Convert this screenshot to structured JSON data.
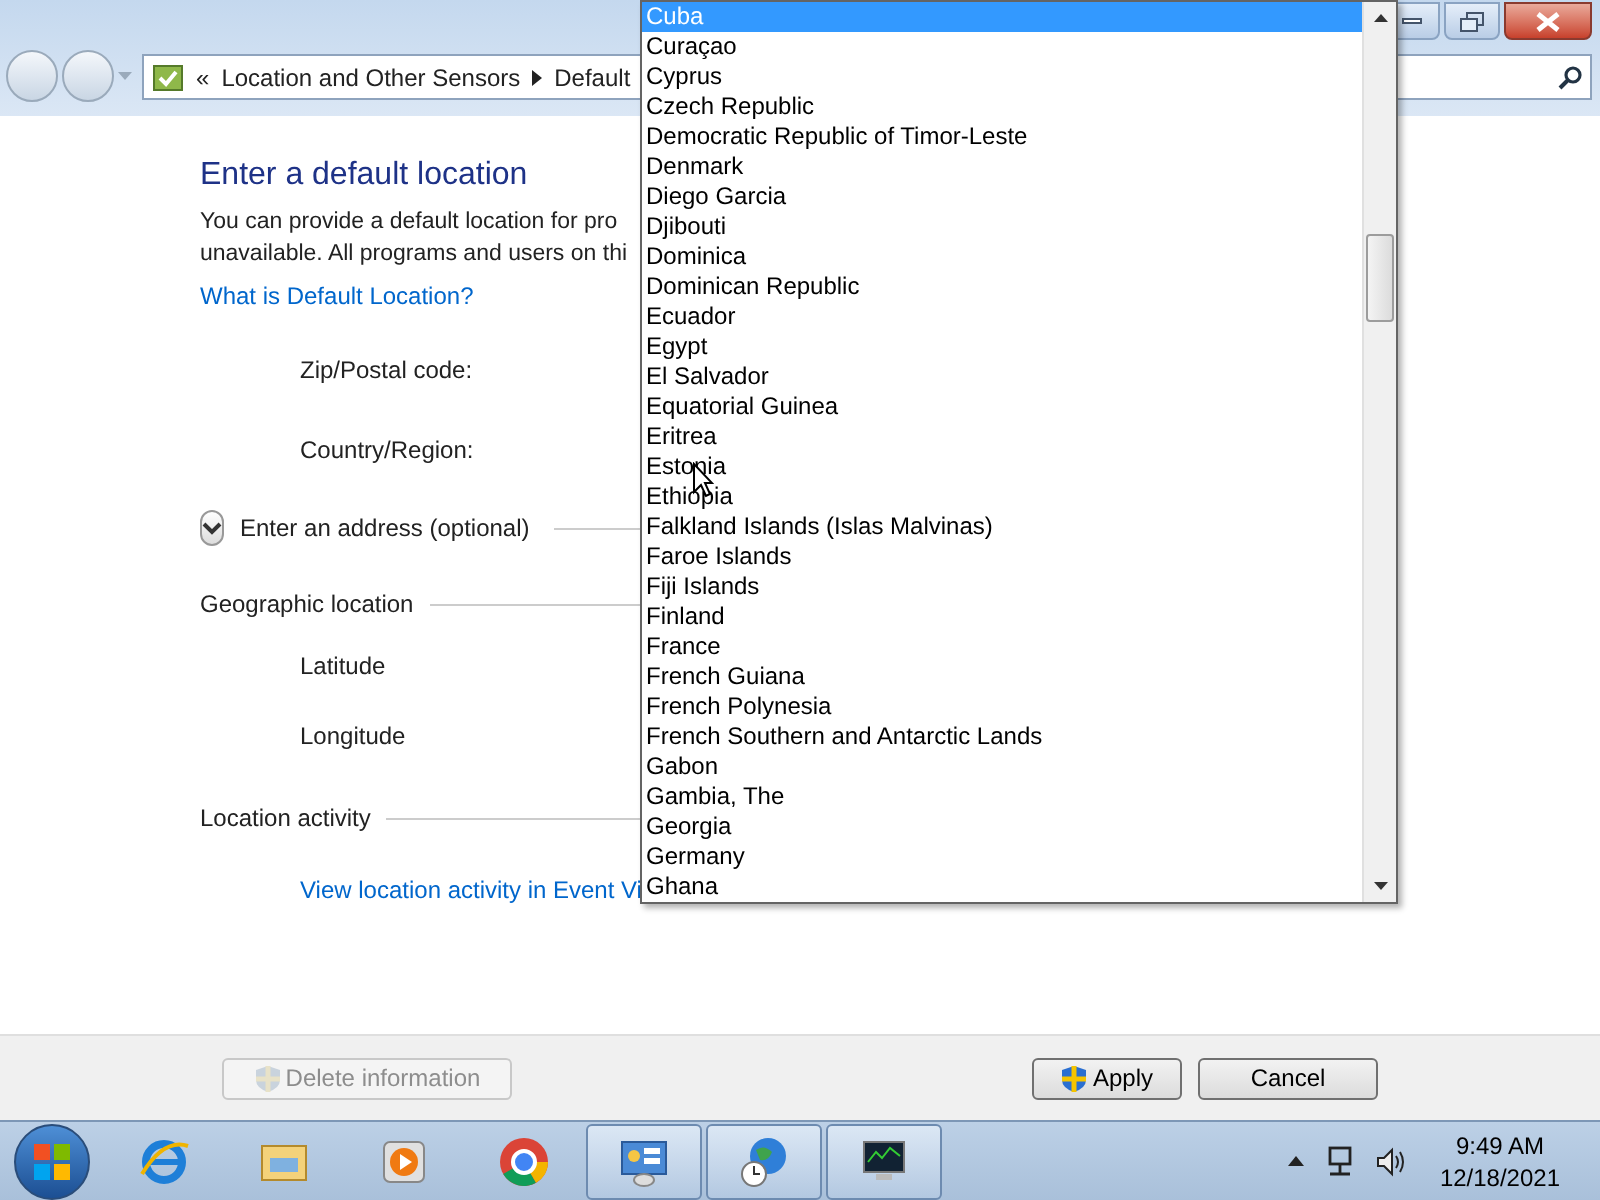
{
  "address_bar": {
    "overflow": "«",
    "crumbs": [
      "Location and Other Sensors",
      "Default"
    ]
  },
  "content": {
    "title": "Enter a default location",
    "intro_lines": [
      "You can provide a default location for pro",
      "unavailable. All programs and users on thi"
    ],
    "help_link": "What is Default Location?",
    "fields": [
      {
        "label": "Zip/Postal code:"
      },
      {
        "label": "Country/Region:"
      }
    ],
    "address_section": {
      "label": "Enter an address (optional)",
      "expanded": false
    },
    "geo_section": "Geographic location",
    "geo_fields": [
      "Latitude",
      "Longitude"
    ],
    "activity_section": "Location activity",
    "activity_link": "View location activity in Event Vi"
  },
  "country_list": [
    {
      "label": "Cuba",
      "selected": true
    },
    {
      "label": "Curaçao",
      "selected": false
    },
    {
      "label": "Cyprus",
      "selected": false
    },
    {
      "label": "Czech Republic",
      "selected": false
    },
    {
      "label": "Democratic Republic of Timor-Leste",
      "selected": false
    },
    {
      "label": "Denmark",
      "selected": false
    },
    {
      "label": "Diego Garcia",
      "selected": false
    },
    {
      "label": "Djibouti",
      "selected": false
    },
    {
      "label": "Dominica",
      "selected": false
    },
    {
      "label": "Dominican Republic",
      "selected": false
    },
    {
      "label": "Ecuador",
      "selected": false
    },
    {
      "label": "Egypt",
      "selected": false
    },
    {
      "label": "El Salvador",
      "selected": false
    },
    {
      "label": "Equatorial Guinea",
      "selected": false
    },
    {
      "label": "Eritrea",
      "selected": false
    },
    {
      "label": "Estonia",
      "selected": false
    },
    {
      "label": "Ethiopia",
      "selected": false
    },
    {
      "label": "Falkland Islands (Islas Malvinas)",
      "selected": false
    },
    {
      "label": "Faroe Islands",
      "selected": false
    },
    {
      "label": "Fiji Islands",
      "selected": false
    },
    {
      "label": "Finland",
      "selected": false
    },
    {
      "label": "France",
      "selected": false
    },
    {
      "label": "French Guiana",
      "selected": false
    },
    {
      "label": "French Polynesia",
      "selected": false
    },
    {
      "label": "French Southern and Antarctic Lands",
      "selected": false
    },
    {
      "label": "Gabon",
      "selected": false
    },
    {
      "label": "Gambia, The",
      "selected": false
    },
    {
      "label": "Georgia",
      "selected": false
    },
    {
      "label": "Germany",
      "selected": false
    },
    {
      "label": "Ghana",
      "selected": false
    }
  ],
  "buttons": [
    {
      "label": "Delete information",
      "disabled": true,
      "shield": true
    },
    {
      "label": "Apply",
      "disabled": false,
      "shield": true
    },
    {
      "label": "Cancel",
      "disabled": false,
      "shield": false
    }
  ],
  "taskbar": {
    "apps": [
      {
        "kind": "ie",
        "active": false
      },
      {
        "kind": "folder",
        "active": false
      },
      {
        "kind": "media",
        "active": false
      },
      {
        "kind": "chrome",
        "active": false
      },
      {
        "kind": "control",
        "active": true
      },
      {
        "kind": "globe",
        "active": true
      },
      {
        "kind": "monitor",
        "active": true
      }
    ],
    "time": "9:49 AM",
    "date": "12/18/2021"
  }
}
